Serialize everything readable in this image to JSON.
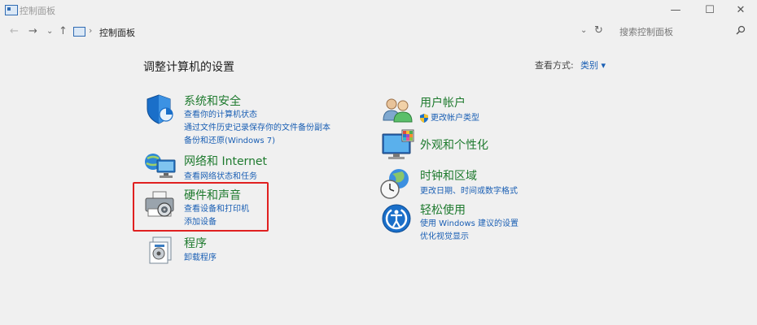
{
  "window": {
    "title": "控制面板",
    "minimize": "—",
    "maximize": "☐",
    "close": "✕"
  },
  "address": {
    "back": "←",
    "forward": "→",
    "history": "⌄",
    "up": "↑",
    "breadcrumb_sep": "›",
    "breadcrumb": "控制面板",
    "dropdown": "⌄",
    "refresh": "↻",
    "search_placeholder": "搜索控制面板"
  },
  "main": {
    "title": "调整计算机的设置",
    "view_by_label": "查看方式:",
    "view_by_value": "类别 ▾"
  },
  "left_categories": [
    {
      "title": "系统和安全",
      "links": [
        "查看你的计算机状态",
        "通过文件历史记录保存你的文件备份副本",
        "备份和还原(Windows 7)"
      ]
    },
    {
      "title": "网络和 Internet",
      "links": [
        "查看网络状态和任务"
      ]
    },
    {
      "title": "硬件和声音",
      "links": [
        "查看设备和打印机",
        "添加设备"
      ]
    },
    {
      "title": "程序",
      "links": [
        "卸载程序"
      ]
    }
  ],
  "right_categories": [
    {
      "title": "用户帐户",
      "links": [
        "更改帐户类型"
      ]
    },
    {
      "title": "外观和个性化",
      "links": []
    },
    {
      "title": "时钟和区域",
      "links": [
        "更改日期、时间或数字格式"
      ]
    },
    {
      "title": "轻松使用",
      "links": [
        "使用 Windows 建议的设置",
        "优化视觉显示"
      ]
    }
  ],
  "colors": {
    "category_title": "#1e7a2e",
    "link": "#1a5fb4",
    "highlight": "#e02020"
  },
  "icons": [
    "shield-icon",
    "network-icon",
    "hardware-sound-icon",
    "programs-icon",
    "users-icon",
    "appearance-icon",
    "clock-region-icon",
    "ease-of-access-icon"
  ]
}
